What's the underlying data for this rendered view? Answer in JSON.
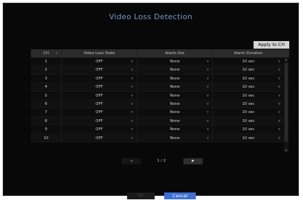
{
  "dialog": {
    "title": "Video Loss Detection",
    "apply_label": "Apply to CH"
  },
  "table": {
    "headers": [
      "CH",
      "Video Loss State",
      "Alarm Out",
      "Alarm Duration"
    ],
    "rows": [
      {
        "ch": "1",
        "state": "OFF",
        "alarm": "None",
        "duration": "10 sec"
      },
      {
        "ch": "2",
        "state": "OFF",
        "alarm": "None",
        "duration": "10 sec"
      },
      {
        "ch": "3",
        "state": "OFF",
        "alarm": "None",
        "duration": "10 sec"
      },
      {
        "ch": "4",
        "state": "OFF",
        "alarm": "None",
        "duration": "10 sec"
      },
      {
        "ch": "5",
        "state": "OFF",
        "alarm": "None",
        "duration": "10 sec"
      },
      {
        "ch": "6",
        "state": "OFF",
        "alarm": "None",
        "duration": "10 sec"
      },
      {
        "ch": "7",
        "state": "OFF",
        "alarm": "None",
        "duration": "10 sec"
      },
      {
        "ch": "8",
        "state": "OFF",
        "alarm": "None",
        "duration": "10 sec"
      },
      {
        "ch": "9",
        "state": "OFF",
        "alarm": "None",
        "duration": "10 sec"
      },
      {
        "ch": "10",
        "state": "OFF",
        "alarm": "None",
        "duration": "10 sec"
      }
    ]
  },
  "pager": {
    "text": "1 / 2"
  },
  "footer": {
    "ok_label": "OK",
    "cancel_label": "Cancel"
  },
  "icons": {
    "dropdown": "chevron-down-icon",
    "prev": "chevron-left-icon",
    "next": "chevron-right-icon",
    "scroll_up": "chevron-up-icon",
    "scroll_down": "chevron-down-icon"
  },
  "colors": {
    "title": "#7a96c8",
    "dialog_bg": "#080808",
    "accent": "#3f6fd6",
    "header_bg": "#2b2b2b"
  }
}
